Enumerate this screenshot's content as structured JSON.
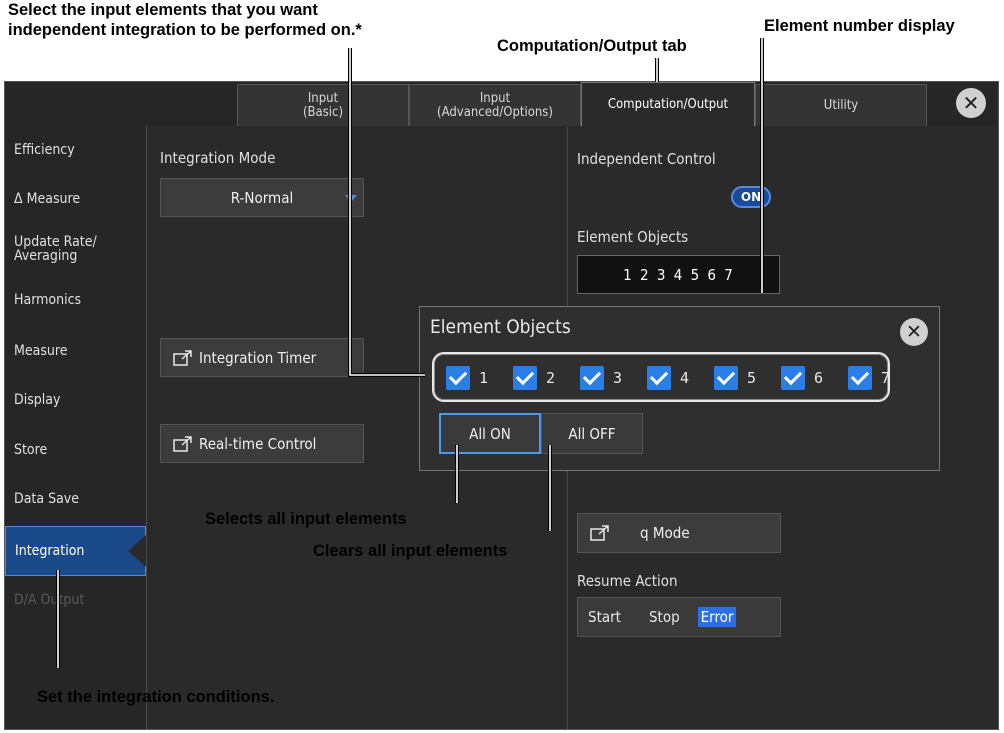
{
  "callouts": {
    "select_elements_line1": "Select the input elements that you want",
    "select_elements_line2": "independent integration to be performed on.*",
    "computation_tab": "Computation/Output tab",
    "element_number_display": "Element number display",
    "selects_all": "Selects all input elements",
    "clears_all": "Clears all input elements",
    "set_integration": "Set the integration conditions."
  },
  "tabs": [
    {
      "line1": "Input",
      "line2": "(Basic)"
    },
    {
      "line1": "Input",
      "line2": "(Advanced/Options)"
    },
    {
      "line1": "Computation/Output",
      "line2": ""
    },
    {
      "line1": "Utility",
      "line2": ""
    }
  ],
  "sidebar": {
    "items": [
      {
        "label": "Efficiency"
      },
      {
        "label": "Δ Measure"
      },
      {
        "label": "Update Rate/\nAveraging"
      },
      {
        "label": "Harmonics"
      },
      {
        "label": "Measure"
      },
      {
        "label": "Display"
      },
      {
        "label": "Store"
      },
      {
        "label": "Data Save"
      },
      {
        "label": "Integration"
      },
      {
        "label": "D/A Output"
      }
    ]
  },
  "main": {
    "integration_mode_label": "Integration Mode",
    "integration_mode_value": "R-Normal",
    "integration_timer_label": "Integration Timer",
    "realtime_control_label": "Real-time Control",
    "independent_control_label": "Independent Control",
    "independent_control_state": "ON",
    "element_objects_label": "Element Objects",
    "element_objects_value": "1 2 3 4 5 6 7",
    "q_mode_label": "q Mode",
    "resume_action_label": "Resume Action",
    "resume_options": [
      "Start",
      "Stop",
      "Error"
    ],
    "resume_selected": "Error"
  },
  "popup": {
    "title": "Element Objects",
    "elements": [
      "1",
      "2",
      "3",
      "4",
      "5",
      "6",
      "7"
    ],
    "all_on_label": "All ON",
    "all_off_label": "All OFF"
  },
  "colors": {
    "accent": "#2a7ee8",
    "background": "#2a2a2a",
    "active_nav": "#1a4a8a"
  }
}
